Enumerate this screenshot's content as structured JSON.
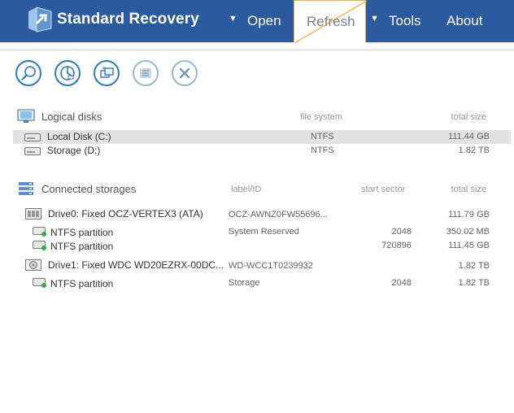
{
  "header": {
    "app_title": "Standard Recovery",
    "menu": [
      {
        "label": "Open"
      },
      {
        "label": "Refresh"
      },
      {
        "label": "Tools"
      },
      {
        "label": "About"
      }
    ],
    "colors": {
      "bar": "#2b5aa0",
      "accent": "#f0b14a"
    }
  },
  "toolbar": {
    "icons": [
      "search-icon",
      "chart-icon",
      "copy-icon",
      "list-icon",
      "close-icon"
    ]
  },
  "logical_disks": {
    "title": "Logical disks",
    "columns": {
      "fs": "file system",
      "size": "total size"
    },
    "rows": [
      {
        "name": "Local Disk (C:)",
        "fs": "NTFS",
        "size": "111.44 GB",
        "selected": true
      },
      {
        "name": "Storage (D:)",
        "fs": "NTFS",
        "size": "1.82 TB",
        "selected": false
      }
    ]
  },
  "connected_storages": {
    "title": "Connected storages",
    "columns": {
      "label": "label/ID",
      "start": "start sector",
      "size": "total size"
    },
    "rows": [
      {
        "name": "Drive0: Fixed OCZ-VERTEX3 (ATA)",
        "label": "OCZ-AWNZ0FW55696...",
        "start": "",
        "size": "111.79 GB",
        "type": "drive"
      },
      {
        "name": "NTFS partition",
        "label": "System Reserved",
        "start": "2048",
        "size": "350.02 MB",
        "type": "partition"
      },
      {
        "name": "NTFS partition",
        "label": "",
        "start": "720896",
        "size": "111.45 GB",
        "type": "partition"
      },
      {
        "name": "Drive1: Fixed WDC WD20EZRX-00DC...",
        "label": "WD-WCC1T0239932",
        "start": "",
        "size": "1.82 TB",
        "type": "drive"
      },
      {
        "name": "NTFS partition",
        "label": "Storage",
        "start": "2048",
        "size": "1.82 TB",
        "type": "partition"
      }
    ]
  }
}
